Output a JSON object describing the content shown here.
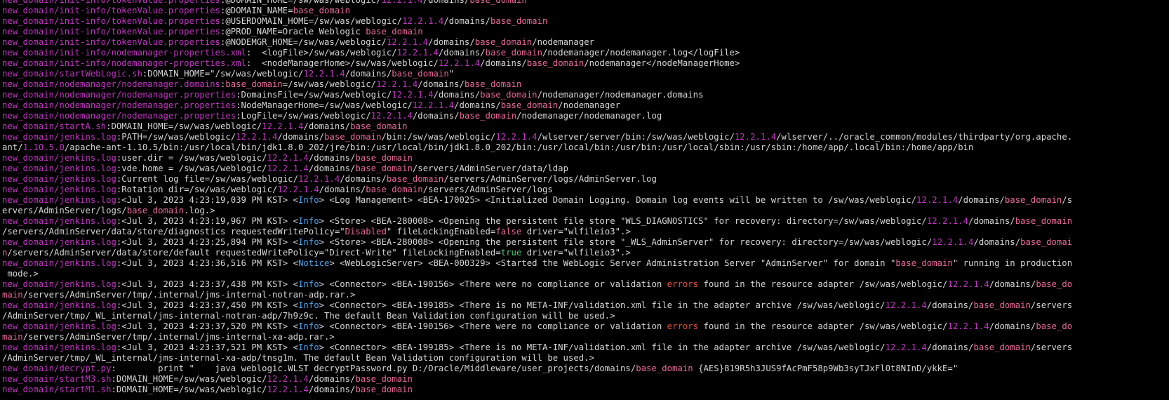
{
  "colors": {
    "background": "#000000",
    "text": "#d6d6d6",
    "file_path": "#c036c0",
    "version": "#c036c0",
    "domain_name": "#e9699a",
    "log_level": "#4aa3ee",
    "error_word": "#e0533c",
    "true_value": "#50c878"
  },
  "lines": [
    [
      [
        "p",
        "new_domain/init-info/tokenValue.properties"
      ],
      [
        "t",
        ":@DOMAIN_HOME=/sw/was/weblogic/"
      ],
      [
        "v",
        "12.2.1.4"
      ],
      [
        "t",
        "/domains/"
      ],
      [
        "d",
        "base_domain"
      ]
    ],
    [
      [
        "p",
        "new_domain/init-info/tokenValue.properties"
      ],
      [
        "t",
        ":@DOMAIN_NAME="
      ],
      [
        "d",
        "base_domain"
      ]
    ],
    [
      [
        "p",
        "new_domain/init-info/tokenValue.properties"
      ],
      [
        "t",
        ":@USERDOMAIN_HOME=/sw/was/weblogic/"
      ],
      [
        "v",
        "12.2.1.4"
      ],
      [
        "t",
        "/domains/"
      ],
      [
        "d",
        "base_domain"
      ]
    ],
    [
      [
        "p",
        "new_domain/init-info/tokenValue.properties"
      ],
      [
        "t",
        ":@PROD_NAME=Oracle Weblogic "
      ],
      [
        "d",
        "base_domain"
      ]
    ],
    [
      [
        "p",
        "new_domain/init-info/tokenValue.properties"
      ],
      [
        "t",
        ":@NODEMGR_HOME=/sw/was/weblogic/"
      ],
      [
        "v",
        "12.2.1.4"
      ],
      [
        "t",
        "/domains/"
      ],
      [
        "d",
        "base_domain"
      ],
      [
        "t",
        "/nodemanager"
      ]
    ],
    [
      [
        "p",
        "new_domain/init-info/nodemanager-properties.xml"
      ],
      [
        "t",
        ":  <logFile>/sw/was/weblogic/"
      ],
      [
        "v",
        "12.2.1.4"
      ],
      [
        "t",
        "/domains/"
      ],
      [
        "d",
        "base_domain"
      ],
      [
        "t",
        "/nodemanager/nodemanager.log</logFile>"
      ]
    ],
    [
      [
        "p",
        "new_domain/init-info/nodemanager-properties.xml"
      ],
      [
        "t",
        ":  <nodeManagerHome>/sw/was/weblogic/"
      ],
      [
        "v",
        "12.2.1.4"
      ],
      [
        "t",
        "/domains/"
      ],
      [
        "d",
        "base_domain"
      ],
      [
        "t",
        "/nodemanager</nodeManagerHome>"
      ]
    ],
    [
      [
        "p",
        "new_domain/startWebLogic.sh"
      ],
      [
        "t",
        ":DOMAIN_HOME=\"/sw/was/weblogic/"
      ],
      [
        "v",
        "12.2.1.4"
      ],
      [
        "t",
        "/domains/"
      ],
      [
        "d",
        "base_domain"
      ],
      [
        "t",
        "\""
      ]
    ],
    [
      [
        "p",
        "new_domain/nodemanager/nodemanager.domains"
      ],
      [
        "t",
        ":"
      ],
      [
        "d",
        "base_domain"
      ],
      [
        "t",
        "=/sw/was/weblogic/"
      ],
      [
        "v",
        "12.2.1.4"
      ],
      [
        "t",
        "/domains/"
      ],
      [
        "d",
        "base_domain"
      ]
    ],
    [
      [
        "p",
        "new_domain/nodemanager/nodemanager.properties"
      ],
      [
        "t",
        ":DomainsFile=/sw/was/weblogic/"
      ],
      [
        "v",
        "12.2.1.4"
      ],
      [
        "t",
        "/domains/"
      ],
      [
        "d",
        "base_domain"
      ],
      [
        "t",
        "/nodemanager/nodemanager.domains"
      ]
    ],
    [
      [
        "p",
        "new_domain/nodemanager/nodemanager.properties"
      ],
      [
        "t",
        ":NodeManagerHome=/sw/was/weblogic/"
      ],
      [
        "v",
        "12.2.1.4"
      ],
      [
        "t",
        "/domains/"
      ],
      [
        "d",
        "base_domain"
      ],
      [
        "t",
        "/nodemanager"
      ]
    ],
    [
      [
        "p",
        "new_domain/nodemanager/nodemanager.properties"
      ],
      [
        "t",
        ":LogFile=/sw/was/weblogic/"
      ],
      [
        "v",
        "12.2.1.4"
      ],
      [
        "t",
        "/domains/"
      ],
      [
        "d",
        "base_domain"
      ],
      [
        "t",
        "/nodemanager/nodemanager.log"
      ]
    ],
    [
      [
        "p",
        "new_domain/startA.sh"
      ],
      [
        "t",
        ":DOMAIN_HOME=/sw/was/weblogic/"
      ],
      [
        "v",
        "12.2.1.4"
      ],
      [
        "t",
        "/domains/"
      ],
      [
        "d",
        "base_domain"
      ]
    ],
    [
      [
        "p",
        "new_domain/jenkins.log"
      ],
      [
        "t",
        ":PATH=/sw/was/weblogic/"
      ],
      [
        "v",
        "12.2.1.4"
      ],
      [
        "t",
        "/domains/"
      ],
      [
        "d",
        "base_domain"
      ],
      [
        "t",
        "/bin:/sw/was/weblogic/"
      ],
      [
        "v",
        "12.2.1.4"
      ],
      [
        "t",
        "/wlserver/server/bin:/sw/was/weblogic/"
      ],
      [
        "v",
        "12.2.1.4"
      ],
      [
        "t",
        "/wlserver/../oracle_common/modules/thirdparty/org.apache."
      ]
    ],
    [
      [
        "t",
        "ant/"
      ],
      [
        "v",
        "1.10.5.0"
      ],
      [
        "t",
        "/apache-ant-1.10.5/bin:/usr/local/bin/jdk1.8.0_202/jre/bin:/usr/local/bin/jdk1.8.0_202/bin:/usr/local/bin:/usr/bin:/usr/local/sbin:/usr/sbin:/home/app/.local/bin:/home/app/bin"
      ]
    ],
    [
      [
        "p",
        "new_domain/jenkins.log"
      ],
      [
        "t",
        ":user.dir = /sw/was/weblogic/"
      ],
      [
        "v",
        "12.2.1.4"
      ],
      [
        "t",
        "/domains/"
      ],
      [
        "d",
        "base_domain"
      ]
    ],
    [
      [
        "p",
        "new_domain/jenkins.log"
      ],
      [
        "t",
        ":vde.home = /sw/was/weblogic/"
      ],
      [
        "v",
        "12.2.1.4"
      ],
      [
        "t",
        "/domains/"
      ],
      [
        "d",
        "base_domain"
      ],
      [
        "t",
        "/servers/AdminServer/data/ldap"
      ]
    ],
    [
      [
        "p",
        "new_domain/jenkins.log"
      ],
      [
        "t",
        ":Current log file=/sw/was/weblogic/"
      ],
      [
        "v",
        "12.2.1.4"
      ],
      [
        "t",
        "/domains/"
      ],
      [
        "d",
        "base_domain"
      ],
      [
        "t",
        "/servers/AdminServer/logs/AdminServer.log"
      ]
    ],
    [
      [
        "p",
        "new_domain/jenkins.log"
      ],
      [
        "t",
        ":Rotation dir=/sw/was/weblogic/"
      ],
      [
        "v",
        "12.2.1.4"
      ],
      [
        "t",
        "/domains/"
      ],
      [
        "d",
        "base_domain"
      ],
      [
        "t",
        "/servers/AdminServer/logs"
      ]
    ],
    [
      [
        "p",
        "new_domain/jenkins.log"
      ],
      [
        "t",
        ":<Jul 3, 2023 4:23:19,039 PM KST> <"
      ],
      [
        "l",
        "Info"
      ],
      [
        "t",
        "> <Log Management> <BEA-170025> <Initialized Domain Logging. Domain log events will be written to /sw/was/weblogic/"
      ],
      [
        "v",
        "12.2.1.4"
      ],
      [
        "t",
        "/domains/"
      ],
      [
        "d",
        "base_domain"
      ],
      [
        "t",
        "/s"
      ]
    ],
    [
      [
        "t",
        "ervers/AdminServer/logs/"
      ],
      [
        "d",
        "base_domain"
      ],
      [
        "t",
        ".log.>"
      ]
    ],
    [
      [
        "p",
        "new_domain/jenkins.log"
      ],
      [
        "t",
        ":<Jul 3, 2023 4:23:19,967 PM KST> <"
      ],
      [
        "l",
        "Info"
      ],
      [
        "t",
        "> <Store> <BEA-280008> <Opening the persistent file store \"WLS_DIAGNOSTICS\" for recovery: directory=/sw/was/weblogic/"
      ],
      [
        "v",
        "12.2.1.4"
      ],
      [
        "t",
        "/domains/"
      ],
      [
        "d",
        "base_domain"
      ]
    ],
    [
      [
        "t",
        "/servers/AdminServer/data/store/diagnostics requestedWritePolicy=\""
      ],
      [
        "d",
        "Disabled"
      ],
      [
        "t",
        "\" fileLockingEnabled="
      ],
      [
        "b",
        "false"
      ],
      [
        "t",
        " driver=\"wlfileio3\".>"
      ]
    ],
    [
      [
        "p",
        "new_domain/jenkins.log"
      ],
      [
        "t",
        ":<Jul 3, 2023 4:23:25,894 PM KST> <"
      ],
      [
        "l",
        "Info"
      ],
      [
        "t",
        "> <Store> <BEA-280008> <Opening the persistent file store \"_WLS_AdminServer\" for recovery: directory=/sw/was/weblogic/"
      ],
      [
        "v",
        "12.2.1.4"
      ],
      [
        "t",
        "/domains/"
      ],
      [
        "d",
        "base_domai"
      ]
    ],
    [
      [
        "d",
        "n"
      ],
      [
        "t",
        "/servers/AdminServer/data/store/default requestedWritePolicy=\"Direct-Write\" fileLockingEnabled="
      ],
      [
        "g",
        "true"
      ],
      [
        "t",
        " driver=\"wlfileio3\".>"
      ]
    ],
    [
      [
        "p",
        "new_domain/jenkins.log"
      ],
      [
        "t",
        ":<Jul 3, 2023 4:23:36,516 PM KST> <"
      ],
      [
        "l",
        "Notice"
      ],
      [
        "t",
        "> <WebLogicServer> <BEA-000329> <Started the WebLogic Server Administration Server \"AdminServer\" for domain \""
      ],
      [
        "d",
        "base_domain"
      ],
      [
        "t",
        "\" running in production"
      ]
    ],
    [
      [
        "t",
        " mode.>"
      ]
    ],
    [
      [
        "p",
        "new_domain/jenkins.log"
      ],
      [
        "t",
        ":<Jul 3, 2023 4:23:37,438 PM KST> <"
      ],
      [
        "l",
        "Info"
      ],
      [
        "t",
        "> <Connector> <BEA-190156> <There were no compliance or validation "
      ],
      [
        "e",
        "errors"
      ],
      [
        "t",
        " found in the resource adapter /sw/was/weblogic/"
      ],
      [
        "v",
        "12.2.1.4"
      ],
      [
        "t",
        "/domains/"
      ],
      [
        "d",
        "base_do"
      ]
    ],
    [
      [
        "d",
        "main"
      ],
      [
        "t",
        "/servers/AdminServer/tmp/.internal/jms-internal-notran-adp.rar.>"
      ]
    ],
    [
      [
        "p",
        "new_domain/jenkins.log"
      ],
      [
        "t",
        ":<Jul 3, 2023 4:23:37,450 PM KST> <"
      ],
      [
        "l",
        "Info"
      ],
      [
        "t",
        "> <Connector> <BEA-199185> <There is no META-INF/validation.xml file in the adapter archive /sw/was/weblogic/"
      ],
      [
        "v",
        "12.2.1.4"
      ],
      [
        "t",
        "/domains/"
      ],
      [
        "d",
        "base_domain"
      ],
      [
        "t",
        "/servers"
      ]
    ],
    [
      [
        "t",
        "/AdminServer/tmp/_WL_internal/jms-internal-notran-adp/7h9z9c. The default Bean Validation configuration will be used.>"
      ]
    ],
    [
      [
        "p",
        "new_domain/jenkins.log"
      ],
      [
        "t",
        ":<Jul 3, 2023 4:23:37,520 PM KST> <"
      ],
      [
        "l",
        "Info"
      ],
      [
        "t",
        "> <Connector> <BEA-190156> <There were no compliance or validation "
      ],
      [
        "e",
        "errors"
      ],
      [
        "t",
        " found in the resource adapter /sw/was/weblogic/"
      ],
      [
        "v",
        "12.2.1.4"
      ],
      [
        "t",
        "/domains/"
      ],
      [
        "d",
        "base_do"
      ]
    ],
    [
      [
        "d",
        "main"
      ],
      [
        "t",
        "/servers/AdminServer/tmp/.internal/jms-internal-xa-adp.rar.>"
      ]
    ],
    [
      [
        "p",
        "new_domain/jenkins.log"
      ],
      [
        "t",
        ":<Jul 3, 2023 4:23:37,521 PM KST> <"
      ],
      [
        "l",
        "Info"
      ],
      [
        "t",
        "> <Connector> <BEA-199185> <There is no META-INF/validation.xml file in the adapter archive /sw/was/weblogic/"
      ],
      [
        "v",
        "12.2.1.4"
      ],
      [
        "t",
        "/domains/"
      ],
      [
        "d",
        "base_domain"
      ],
      [
        "t",
        "/servers"
      ]
    ],
    [
      [
        "t",
        "/AdminServer/tmp/_WL_internal/jms-internal-xa-adp/tnsg1m. The default Bean Validation configuration will be used.>"
      ]
    ],
    [
      [
        "p",
        "new_domain/decrypt.py"
      ],
      [
        "t",
        ":        print \"    java weblogic.WLST decryptPassword.py D:/Oracle/Middleware/user_projects/domains/"
      ],
      [
        "d",
        "base_domain"
      ],
      [
        "t",
        " {AES}819R5h3JUS9fAcPmF58p9Wb3syTJxFl0t8NInD/ykkE=\""
      ]
    ],
    [
      [
        "p",
        "new_domain/startM3.sh"
      ],
      [
        "t",
        ":DOMAIN_HOME=/sw/was/weblogic/"
      ],
      [
        "v",
        "12.2.1.4"
      ],
      [
        "t",
        "/domains/"
      ],
      [
        "d",
        "base_domain"
      ]
    ],
    [
      [
        "p",
        "new_domain/startM1.sh"
      ],
      [
        "t",
        ":DOMAIN_HOME=/sw/was/weblogic/"
      ],
      [
        "v",
        "12.2.1.4"
      ],
      [
        "t",
        "/domains/"
      ],
      [
        "d",
        "base_domain"
      ]
    ]
  ]
}
